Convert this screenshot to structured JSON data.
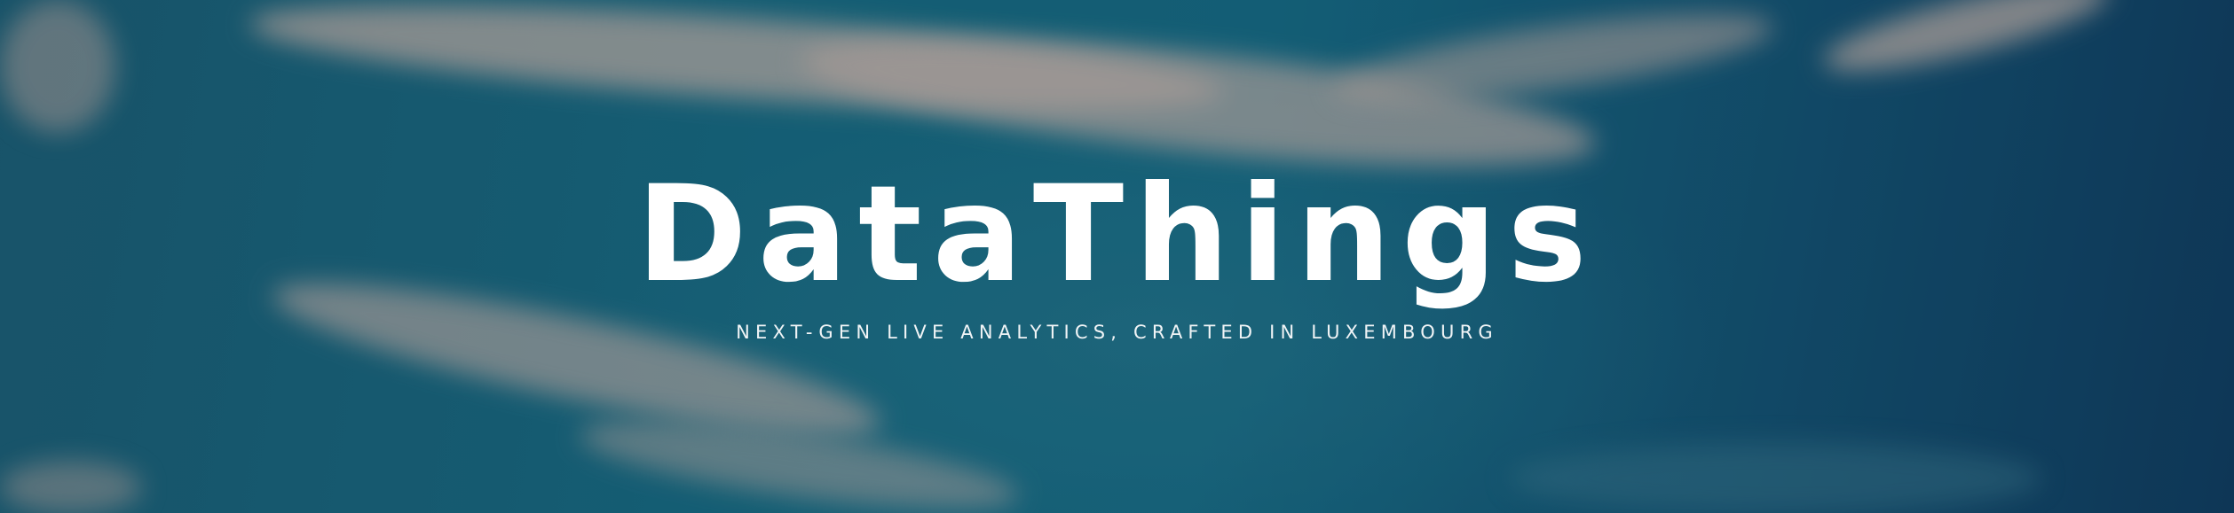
{
  "hero": {
    "title": "DataThings",
    "subtitle": "NEXT-GEN LIVE ANALYTICS, CRAFTED IN LUXEMBOURG"
  },
  "colors": {
    "sky": "#176a80",
    "sky_dark": "#0f3a5c",
    "cloud": "#c9b6a8",
    "text": "#ffffff"
  }
}
